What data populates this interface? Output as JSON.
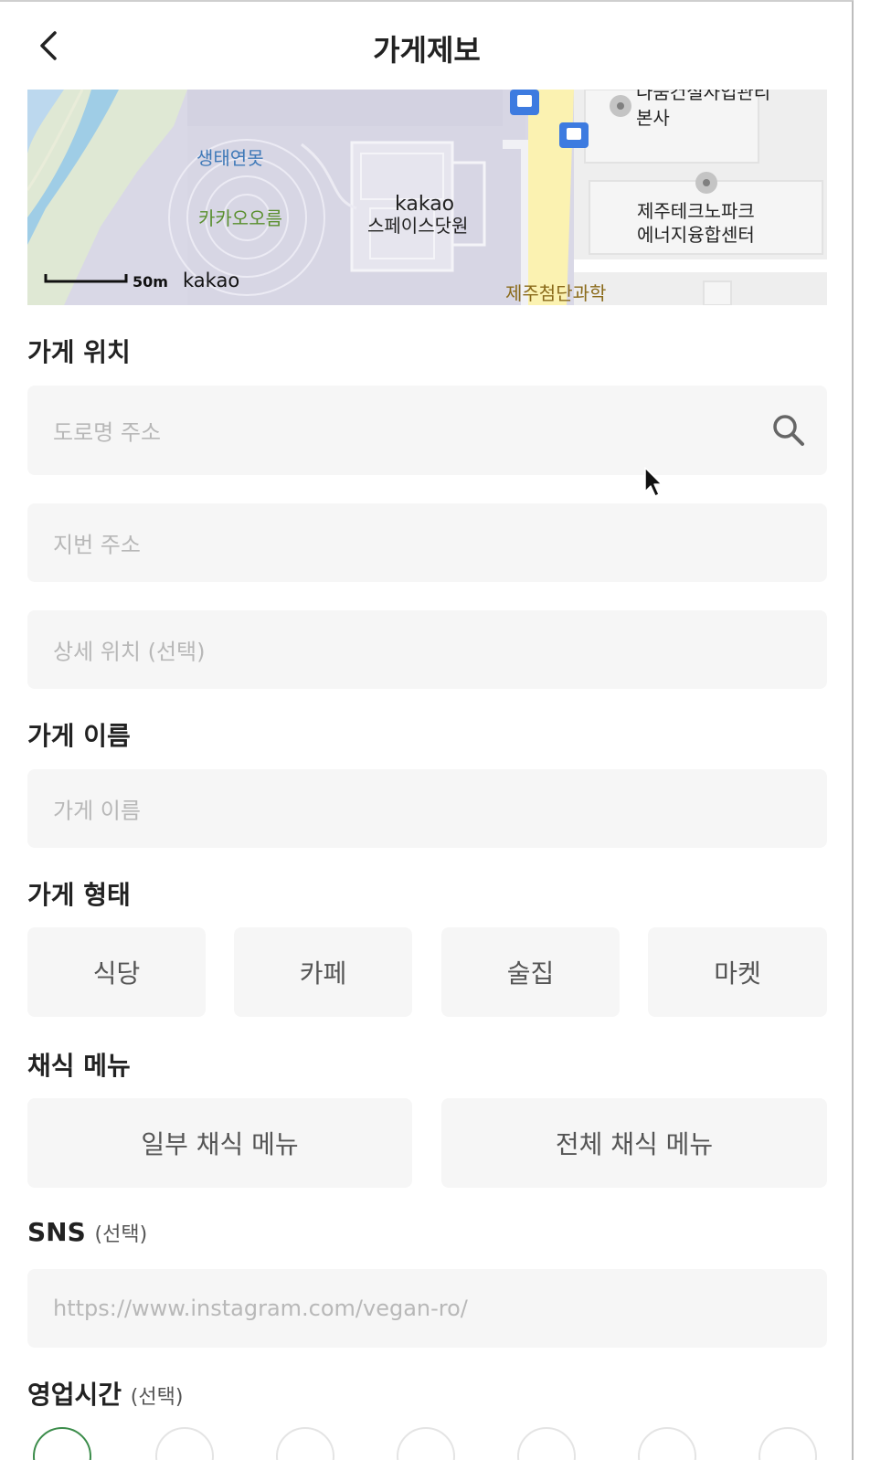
{
  "header": {
    "title": "가게제보"
  },
  "map": {
    "labels": {
      "pond": "생태연못",
      "hill": "카카오오름",
      "building_line1": "kakao",
      "building_line2": "스페이스닷원",
      "org_line1": "나눔건설사업관리",
      "org_line2": "본사",
      "energy_line1": "제주테크노파크",
      "energy_line2": "에너지융합센터",
      "street": "제주첨단과학",
      "scale": "50m",
      "logo": "kakao"
    }
  },
  "location": {
    "title": "가게 위치",
    "road_placeholder": "도로명 주소",
    "lot_placeholder": "지번 주소",
    "detail_placeholder": "상세 위치 (선택)"
  },
  "name": {
    "title": "가게 이름",
    "placeholder": "가게 이름"
  },
  "type": {
    "title": "가게 형태",
    "options": [
      "식당",
      "카페",
      "술집",
      "마켓"
    ]
  },
  "vegan": {
    "title": "채식 메뉴",
    "options": [
      "일부 채식 메뉴",
      "전체 채식 메뉴"
    ]
  },
  "sns": {
    "title": "SNS",
    "optional": "(선택)",
    "placeholder": "https://www.instagram.com/vegan-ro/"
  },
  "hours": {
    "title": "영업시간",
    "optional": "(선택)"
  },
  "colors": {
    "accent": "#3b8c4a",
    "field_bg": "#f6f6f6",
    "placeholder": "#b8b8b8"
  }
}
